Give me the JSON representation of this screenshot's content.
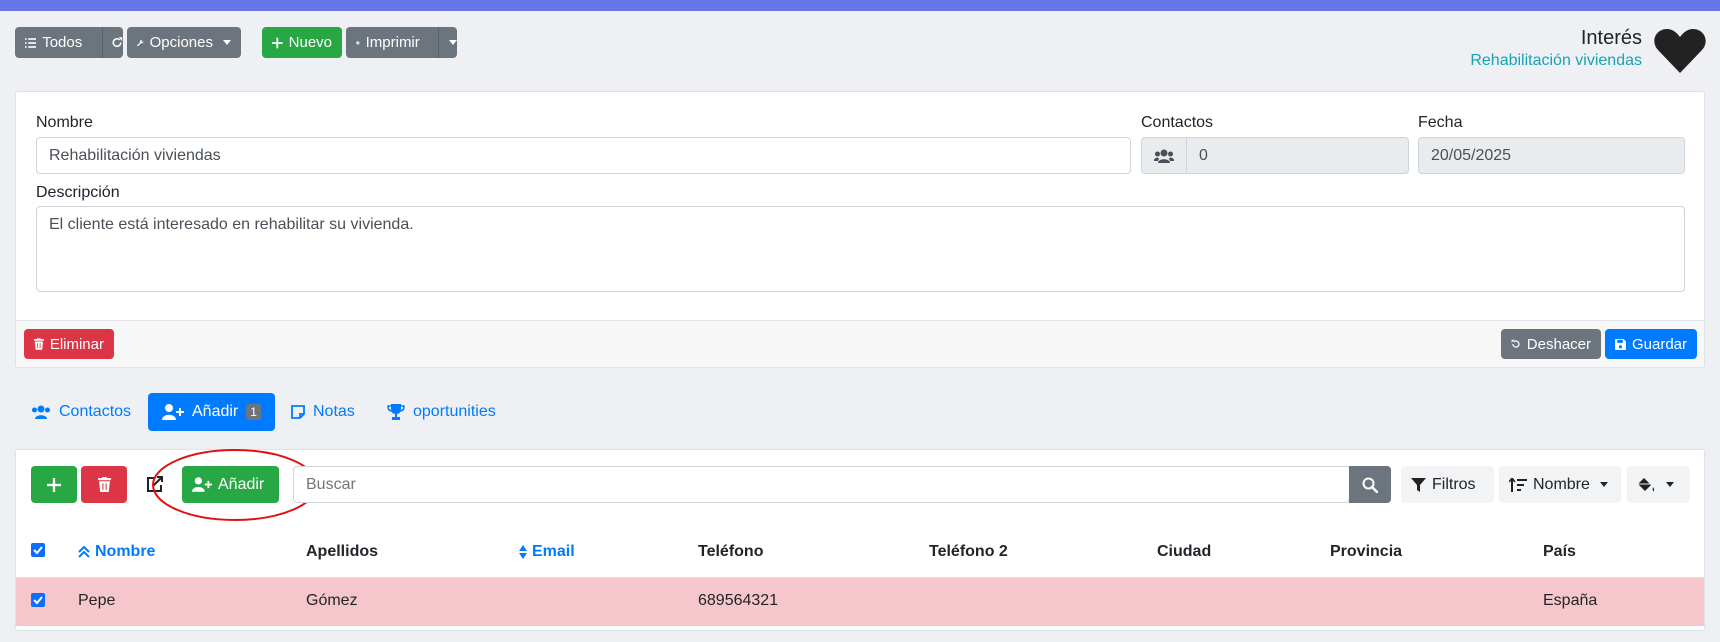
{
  "toolbar": {
    "all_label": "Todos",
    "options_label": "Opciones",
    "new_label": "Nuevo",
    "print_label": "Imprimir"
  },
  "header": {
    "title": "Interés",
    "subtitle": "Rehabilitación viviendas"
  },
  "form": {
    "name_label": "Nombre",
    "name_value": "Rehabilitación viviendas",
    "contacts_label": "Contactos",
    "contacts_value": "0",
    "date_label": "Fecha",
    "date_value": "20/05/2025",
    "description_label": "Descripción",
    "description_value": "El cliente está interesado en rehabilitar su vivienda."
  },
  "form_footer": {
    "delete_label": "Eliminar",
    "undo_label": "Deshacer",
    "save_label": "Guardar"
  },
  "tabs": [
    {
      "label": "Contactos",
      "icon": "users-icon"
    },
    {
      "label": "Añadir",
      "icon": "user-plus-icon",
      "badge": "1",
      "active": true
    },
    {
      "label": "Notas",
      "icon": "note-icon"
    },
    {
      "label": "oportunities",
      "icon": "trophy-icon"
    }
  ],
  "list_toolbar": {
    "add_label": "Añadir",
    "search_placeholder": "Buscar",
    "filters_label": "Filtros",
    "sort_label": "Nombre"
  },
  "table": {
    "headers": [
      "Nombre",
      "Apellidos",
      "Email",
      "Teléfono",
      "Teléfono 2",
      "Ciudad",
      "Provincia",
      "País"
    ],
    "rows": [
      {
        "nombre": "Pepe",
        "apellidos": "Gómez",
        "email": "",
        "telefono": "689564321",
        "telefono2": "",
        "ciudad": "",
        "provincia": "",
        "pais": "España"
      }
    ]
  },
  "colors": {
    "accent": "#007bff",
    "green": "#28a745",
    "red": "#dc3545",
    "grey": "#6c757d",
    "row_highlight": "#f5c6cb",
    "topbar": "#6777e8",
    "annotation": "#e01010"
  }
}
